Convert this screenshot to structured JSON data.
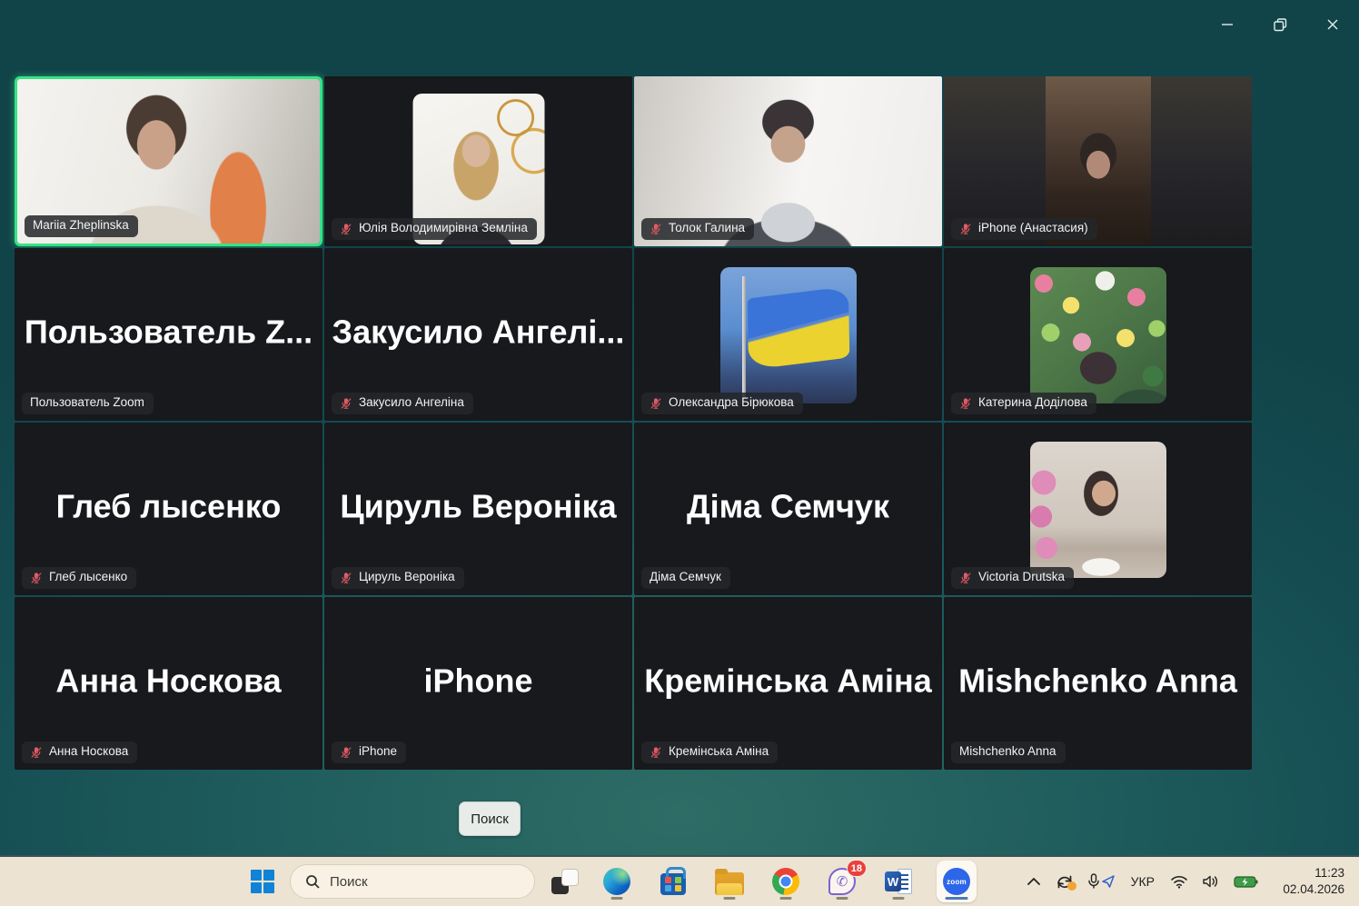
{
  "app": "zoom-meeting-gallery",
  "colors": {
    "background_teal": "#1d5a5b",
    "tile_bg": "#17191d",
    "active_speaker_border": "#35e483",
    "muted_mic_red": "#e05e67",
    "nametag_bg": "rgba(36,38,42,0.86)",
    "taskbar_bg": "#ece3d2",
    "viber_badge_red": "#e8413c"
  },
  "window_controls": {
    "minimize": "minimize",
    "restore": "restore",
    "close": "close"
  },
  "participants": [
    {
      "tag": "Mariia Zheplinska",
      "muted": false,
      "active_speaker": true,
      "video": "camera"
    },
    {
      "tag": "Юлія Володимирівна Земліна",
      "muted": true,
      "video": "avatar-photo"
    },
    {
      "tag": "Толок Галина",
      "muted": true,
      "video": "camera"
    },
    {
      "tag": "iPhone (Анастасия)",
      "muted": true,
      "video": "camera-portrait"
    },
    {
      "display_name": "Пользователь Z...",
      "tag": "Пользователь Zoom",
      "muted": false,
      "video": "none"
    },
    {
      "display_name": "Закусило Ангелі...",
      "tag": "Закусило Ангеліна",
      "muted": true,
      "video": "none"
    },
    {
      "tag": "Олександра Бірюкова",
      "muted": true,
      "video": "avatar-ukraine-flag"
    },
    {
      "tag": "Катерина Доділова",
      "muted": true,
      "video": "avatar-photo"
    },
    {
      "display_name": "Глеб лысенко",
      "tag": "Глеб лысенко",
      "muted": true,
      "video": "none"
    },
    {
      "display_name": "Цируль Вероніка",
      "tag": "Цируль Вероніка",
      "muted": true,
      "video": "none"
    },
    {
      "display_name": "Діма Семчук",
      "tag": "Діма Семчук",
      "muted": false,
      "video": "none"
    },
    {
      "tag": "Victoria Drutska",
      "muted": true,
      "video": "avatar-photo"
    },
    {
      "display_name": "Анна Носкова",
      "tag": "Анна Носкова",
      "muted": true,
      "video": "none"
    },
    {
      "display_name": "iPhone",
      "tag": "iPhone",
      "muted": true,
      "video": "none"
    },
    {
      "display_name": "Кремінська Аміна",
      "tag": "Кремінська Аміна",
      "muted": true,
      "video": "none"
    },
    {
      "display_name": "Mishchenko Anna",
      "tag": "Mishchenko Anna",
      "muted": false,
      "video": "none"
    }
  ],
  "zoom_ui": {
    "search_button": "Поиск"
  },
  "taskbar": {
    "search_placeholder": "Поиск",
    "apps": [
      "task-view",
      "edge",
      "store",
      "file-explorer",
      "chrome",
      "viber",
      "word",
      "zoom"
    ],
    "viber_badge": "18",
    "zoom_icon_label": "zoom",
    "word_icon_letter": "W",
    "viber_phone_glyph": "✆",
    "tray": {
      "language": "УКР",
      "time": "11:23",
      "date": "02.04.2026"
    }
  }
}
